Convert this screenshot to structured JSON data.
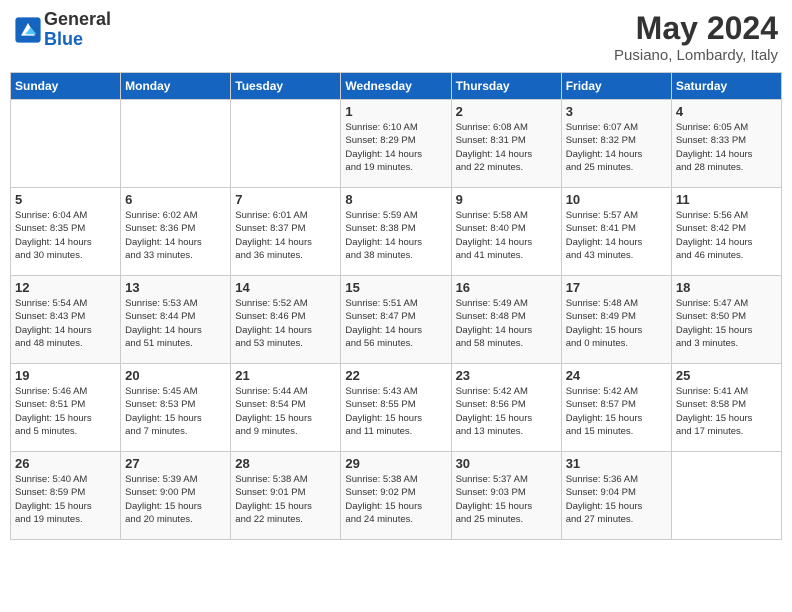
{
  "header": {
    "logo_line1": "General",
    "logo_line2": "Blue",
    "month_title": "May 2024",
    "subtitle": "Pusiano, Lombardy, Italy"
  },
  "days_of_week": [
    "Sunday",
    "Monday",
    "Tuesday",
    "Wednesday",
    "Thursday",
    "Friday",
    "Saturday"
  ],
  "weeks": [
    [
      {
        "day": "",
        "info": ""
      },
      {
        "day": "",
        "info": ""
      },
      {
        "day": "",
        "info": ""
      },
      {
        "day": "1",
        "info": "Sunrise: 6:10 AM\nSunset: 8:29 PM\nDaylight: 14 hours\nand 19 minutes."
      },
      {
        "day": "2",
        "info": "Sunrise: 6:08 AM\nSunset: 8:31 PM\nDaylight: 14 hours\nand 22 minutes."
      },
      {
        "day": "3",
        "info": "Sunrise: 6:07 AM\nSunset: 8:32 PM\nDaylight: 14 hours\nand 25 minutes."
      },
      {
        "day": "4",
        "info": "Sunrise: 6:05 AM\nSunset: 8:33 PM\nDaylight: 14 hours\nand 28 minutes."
      }
    ],
    [
      {
        "day": "5",
        "info": "Sunrise: 6:04 AM\nSunset: 8:35 PM\nDaylight: 14 hours\nand 30 minutes."
      },
      {
        "day": "6",
        "info": "Sunrise: 6:02 AM\nSunset: 8:36 PM\nDaylight: 14 hours\nand 33 minutes."
      },
      {
        "day": "7",
        "info": "Sunrise: 6:01 AM\nSunset: 8:37 PM\nDaylight: 14 hours\nand 36 minutes."
      },
      {
        "day": "8",
        "info": "Sunrise: 5:59 AM\nSunset: 8:38 PM\nDaylight: 14 hours\nand 38 minutes."
      },
      {
        "day": "9",
        "info": "Sunrise: 5:58 AM\nSunset: 8:40 PM\nDaylight: 14 hours\nand 41 minutes."
      },
      {
        "day": "10",
        "info": "Sunrise: 5:57 AM\nSunset: 8:41 PM\nDaylight: 14 hours\nand 43 minutes."
      },
      {
        "day": "11",
        "info": "Sunrise: 5:56 AM\nSunset: 8:42 PM\nDaylight: 14 hours\nand 46 minutes."
      }
    ],
    [
      {
        "day": "12",
        "info": "Sunrise: 5:54 AM\nSunset: 8:43 PM\nDaylight: 14 hours\nand 48 minutes."
      },
      {
        "day": "13",
        "info": "Sunrise: 5:53 AM\nSunset: 8:44 PM\nDaylight: 14 hours\nand 51 minutes."
      },
      {
        "day": "14",
        "info": "Sunrise: 5:52 AM\nSunset: 8:46 PM\nDaylight: 14 hours\nand 53 minutes."
      },
      {
        "day": "15",
        "info": "Sunrise: 5:51 AM\nSunset: 8:47 PM\nDaylight: 14 hours\nand 56 minutes."
      },
      {
        "day": "16",
        "info": "Sunrise: 5:49 AM\nSunset: 8:48 PM\nDaylight: 14 hours\nand 58 minutes."
      },
      {
        "day": "17",
        "info": "Sunrise: 5:48 AM\nSunset: 8:49 PM\nDaylight: 15 hours\nand 0 minutes."
      },
      {
        "day": "18",
        "info": "Sunrise: 5:47 AM\nSunset: 8:50 PM\nDaylight: 15 hours\nand 3 minutes."
      }
    ],
    [
      {
        "day": "19",
        "info": "Sunrise: 5:46 AM\nSunset: 8:51 PM\nDaylight: 15 hours\nand 5 minutes."
      },
      {
        "day": "20",
        "info": "Sunrise: 5:45 AM\nSunset: 8:53 PM\nDaylight: 15 hours\nand 7 minutes."
      },
      {
        "day": "21",
        "info": "Sunrise: 5:44 AM\nSunset: 8:54 PM\nDaylight: 15 hours\nand 9 minutes."
      },
      {
        "day": "22",
        "info": "Sunrise: 5:43 AM\nSunset: 8:55 PM\nDaylight: 15 hours\nand 11 minutes."
      },
      {
        "day": "23",
        "info": "Sunrise: 5:42 AM\nSunset: 8:56 PM\nDaylight: 15 hours\nand 13 minutes."
      },
      {
        "day": "24",
        "info": "Sunrise: 5:42 AM\nSunset: 8:57 PM\nDaylight: 15 hours\nand 15 minutes."
      },
      {
        "day": "25",
        "info": "Sunrise: 5:41 AM\nSunset: 8:58 PM\nDaylight: 15 hours\nand 17 minutes."
      }
    ],
    [
      {
        "day": "26",
        "info": "Sunrise: 5:40 AM\nSunset: 8:59 PM\nDaylight: 15 hours\nand 19 minutes."
      },
      {
        "day": "27",
        "info": "Sunrise: 5:39 AM\nSunset: 9:00 PM\nDaylight: 15 hours\nand 20 minutes."
      },
      {
        "day": "28",
        "info": "Sunrise: 5:38 AM\nSunset: 9:01 PM\nDaylight: 15 hours\nand 22 minutes."
      },
      {
        "day": "29",
        "info": "Sunrise: 5:38 AM\nSunset: 9:02 PM\nDaylight: 15 hours\nand 24 minutes."
      },
      {
        "day": "30",
        "info": "Sunrise: 5:37 AM\nSunset: 9:03 PM\nDaylight: 15 hours\nand 25 minutes."
      },
      {
        "day": "31",
        "info": "Sunrise: 5:36 AM\nSunset: 9:04 PM\nDaylight: 15 hours\nand 27 minutes."
      },
      {
        "day": "",
        "info": ""
      }
    ]
  ]
}
